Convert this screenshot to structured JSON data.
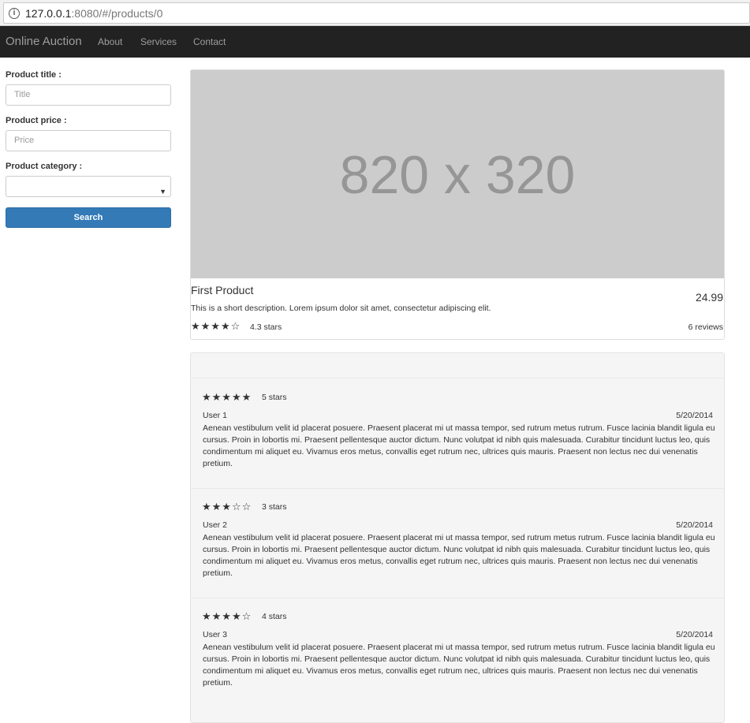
{
  "browser": {
    "url_host": "127.0.0.1",
    "url_rest": ":8080/#/products/0"
  },
  "navbar": {
    "brand": "Online Auction",
    "links": [
      "About",
      "Services",
      "Contact"
    ]
  },
  "search_form": {
    "title_label": "Product title :",
    "title_placeholder": "Title",
    "price_label": "Product price :",
    "price_placeholder": "Price",
    "category_label": "Product category :",
    "category_value": "",
    "search_button": "Search"
  },
  "product": {
    "image_text": "820 x 320",
    "title": "First Product",
    "price": "24.99",
    "description": "This is a short description. Lorem ipsum dolor sit amet, consectetur adipiscing elit.",
    "stars": "★★★★☆",
    "rating_text": "4.3 stars",
    "reviews_text": "6 reviews"
  },
  "reviews": [
    {
      "stars": "★★★★★",
      "stars_text": "5 stars",
      "user": "User 1",
      "date": "5/20/2014",
      "text": "Aenean vestibulum velit id placerat posuere. Praesent placerat mi ut massa tempor, sed rutrum metus rutrum. Fusce lacinia blandit ligula eu cursus. Proin in lobortis mi. Praesent pellentesque auctor dictum. Nunc volutpat id nibh quis malesuada. Curabitur tincidunt luctus leo, quis condimentum mi aliquet eu. Vivamus eros metus, convallis eget rutrum nec, ultrices quis mauris. Praesent non lectus nec dui venenatis pretium."
    },
    {
      "stars": "★★★☆☆",
      "stars_text": "3 stars",
      "user": "User 2",
      "date": "5/20/2014",
      "text": "Aenean vestibulum velit id placerat posuere. Praesent placerat mi ut massa tempor, sed rutrum metus rutrum. Fusce lacinia blandit ligula eu cursus. Proin in lobortis mi. Praesent pellentesque auctor dictum. Nunc volutpat id nibh quis malesuada. Curabitur tincidunt luctus leo, quis condimentum mi aliquet eu. Vivamus eros metus, convallis eget rutrum nec, ultrices quis mauris. Praesent non lectus nec dui venenatis pretium."
    },
    {
      "stars": "★★★★☆",
      "stars_text": "4 stars",
      "user": "User 3",
      "date": "5/20/2014",
      "text": "Aenean vestibulum velit id placerat posuere. Praesent placerat mi ut massa tempor, sed rutrum metus rutrum. Fusce lacinia blandit ligula eu cursus. Proin in lobortis mi. Praesent pellentesque auctor dictum. Nunc volutpat id nibh quis malesuada. Curabitur tincidunt luctus leo, quis condimentum mi aliquet eu. Vivamus eros metus, convallis eget rutrum nec, ultrices quis mauris. Praesent non lectus nec dui venenatis pretium."
    }
  ]
}
